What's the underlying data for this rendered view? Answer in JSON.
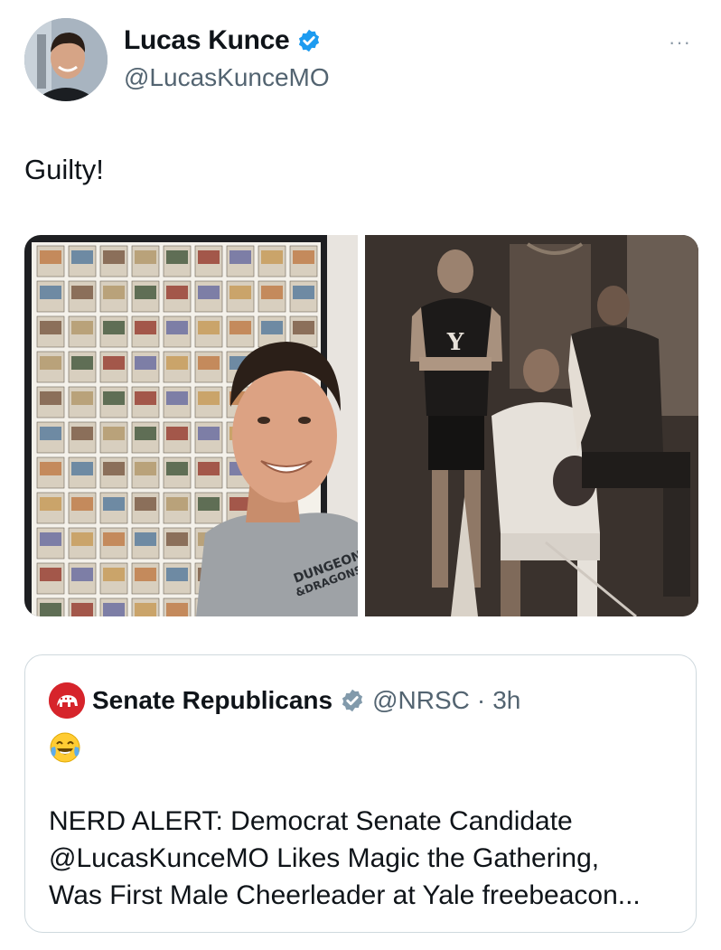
{
  "author": {
    "display_name": "Lucas Kunce",
    "handle": "@LucasKunceMO",
    "verified": true
  },
  "more_menu": "···",
  "tweet": {
    "text": "Guilty!"
  },
  "media": [
    {
      "description_name": "selfie-with-card-collection"
    },
    {
      "description_name": "yale-team-photo"
    }
  ],
  "shirt_text": [
    "DUNGEONS",
    "&DRAGONS"
  ],
  "jersey_letter": "Y",
  "quoted": {
    "display_name": "Senate Republicans",
    "handle": "@NRSC",
    "separator": "·",
    "time": "3h",
    "emoji": "😂",
    "text_lines": [
      "NERD ALERT: Democrat Senate Candidate",
      "@LucasKunceMO Likes Magic the Gathering,",
      "Was First Male Cheerleader at Yale freebeacon..."
    ]
  },
  "colors": {
    "verified_blue": "#1d9bf0",
    "verified_gray": "#829aab",
    "nrsc_red": "#d6242b",
    "handle_gray": "#536471"
  }
}
